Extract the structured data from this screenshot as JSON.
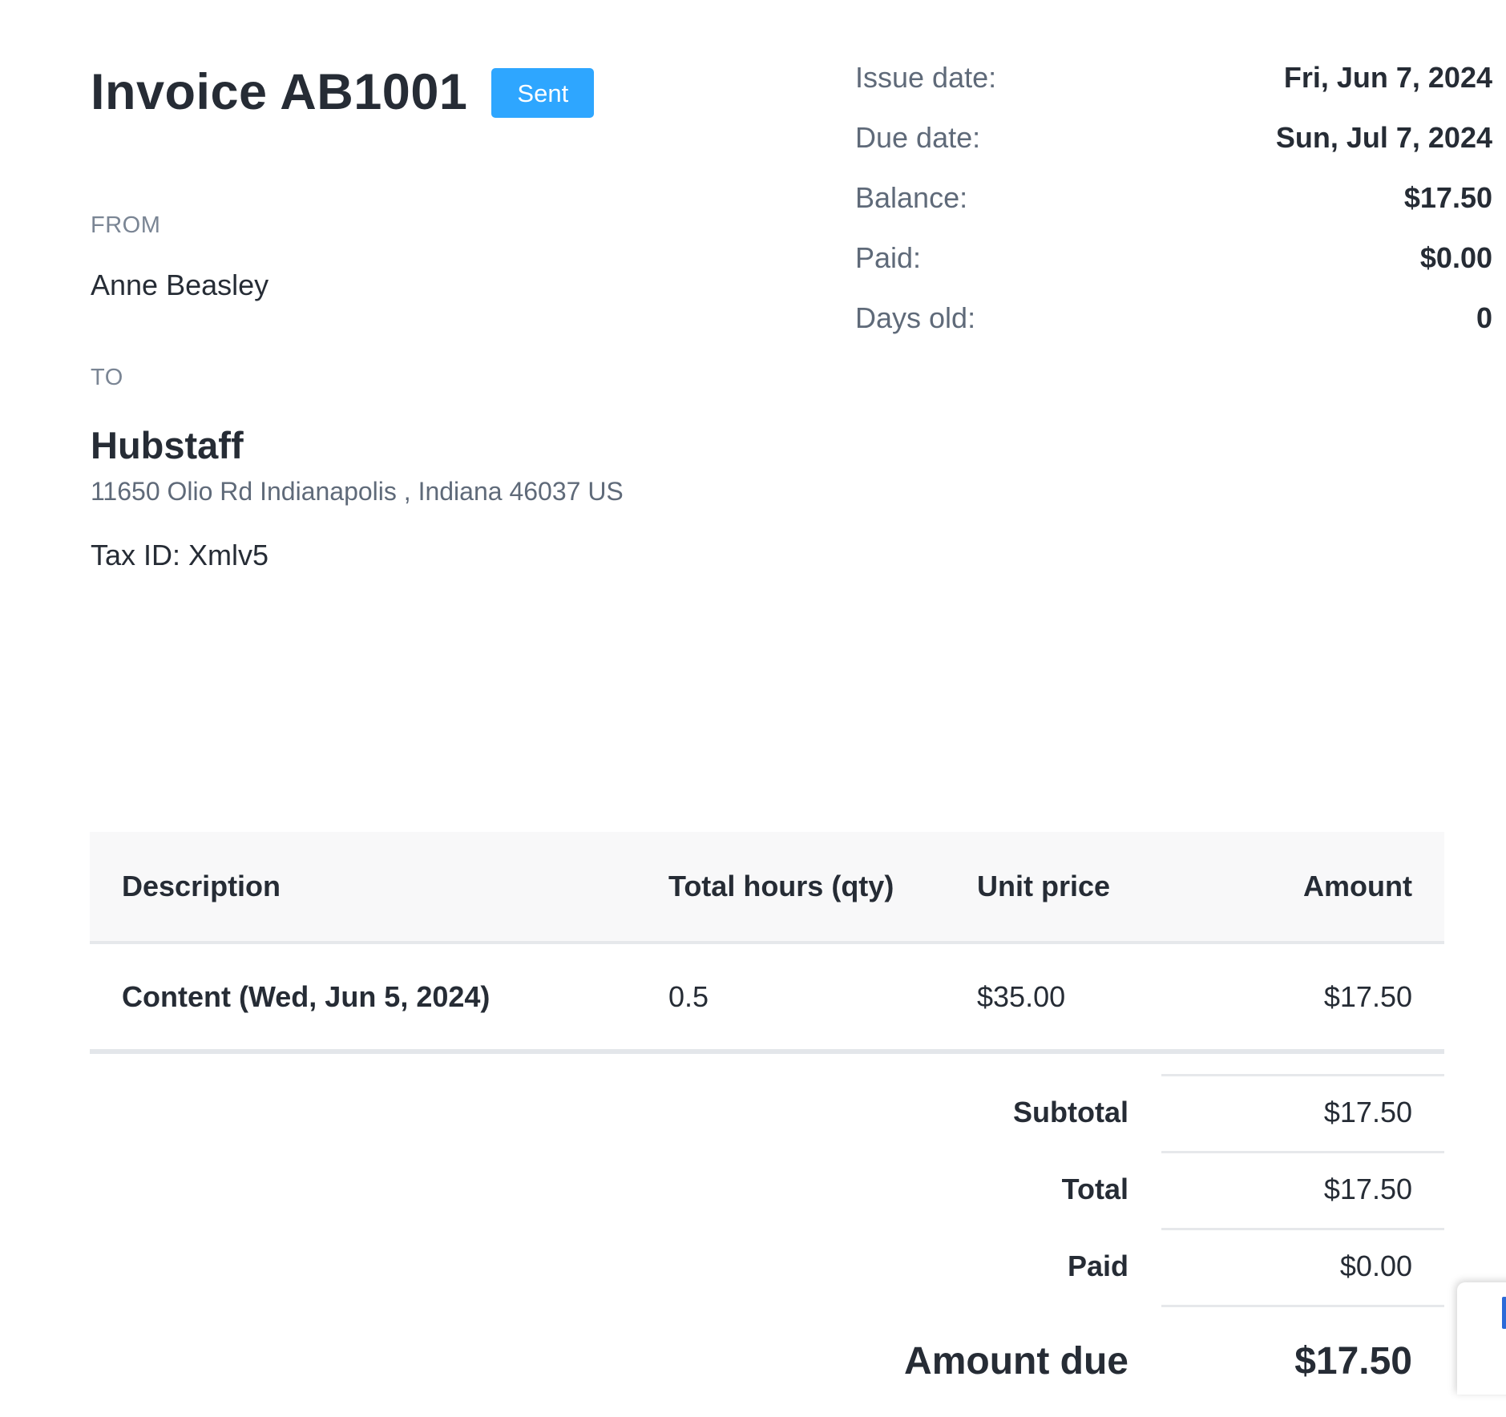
{
  "invoice": {
    "title": "Invoice AB1001",
    "status": "Sent",
    "status_color": "#2ea6ff"
  },
  "from": {
    "label": "FROM",
    "name": "Anne Beasley"
  },
  "to": {
    "label": "TO",
    "name": "Hubstaff",
    "address": "11650 Olio Rd Indianapolis , Indiana 46037 US",
    "tax_id": "Tax ID: Xmlv5"
  },
  "meta": {
    "issue_date_label": "Issue date:",
    "issue_date": "Fri, Jun 7, 2024",
    "due_date_label": "Due date:",
    "due_date": "Sun, Jul 7, 2024",
    "balance_label": "Balance:",
    "balance": "$17.50",
    "paid_label": "Paid:",
    "paid": "$0.00",
    "days_old_label": "Days old:",
    "days_old": "0"
  },
  "table": {
    "headers": [
      "Description",
      "Total hours (qty)",
      "Unit price",
      "Amount"
    ],
    "rows": [
      {
        "description": "Content (Wed, Jun 5, 2024)",
        "qty": "0.5",
        "unit_price": "$35.00",
        "amount": "$17.50"
      }
    ]
  },
  "totals": {
    "subtotal_label": "Subtotal",
    "subtotal": "$17.50",
    "total_label": "Total",
    "total": "$17.50",
    "paid_label": "Paid",
    "paid": "$0.00",
    "amount_due_label": "Amount due",
    "amount_due": "$17.50"
  },
  "colors": {
    "text_primary": "#262c35",
    "text_secondary": "#5f6a79",
    "table_header_bg": "#f8f8f9",
    "divider": "#e6e8eb"
  }
}
